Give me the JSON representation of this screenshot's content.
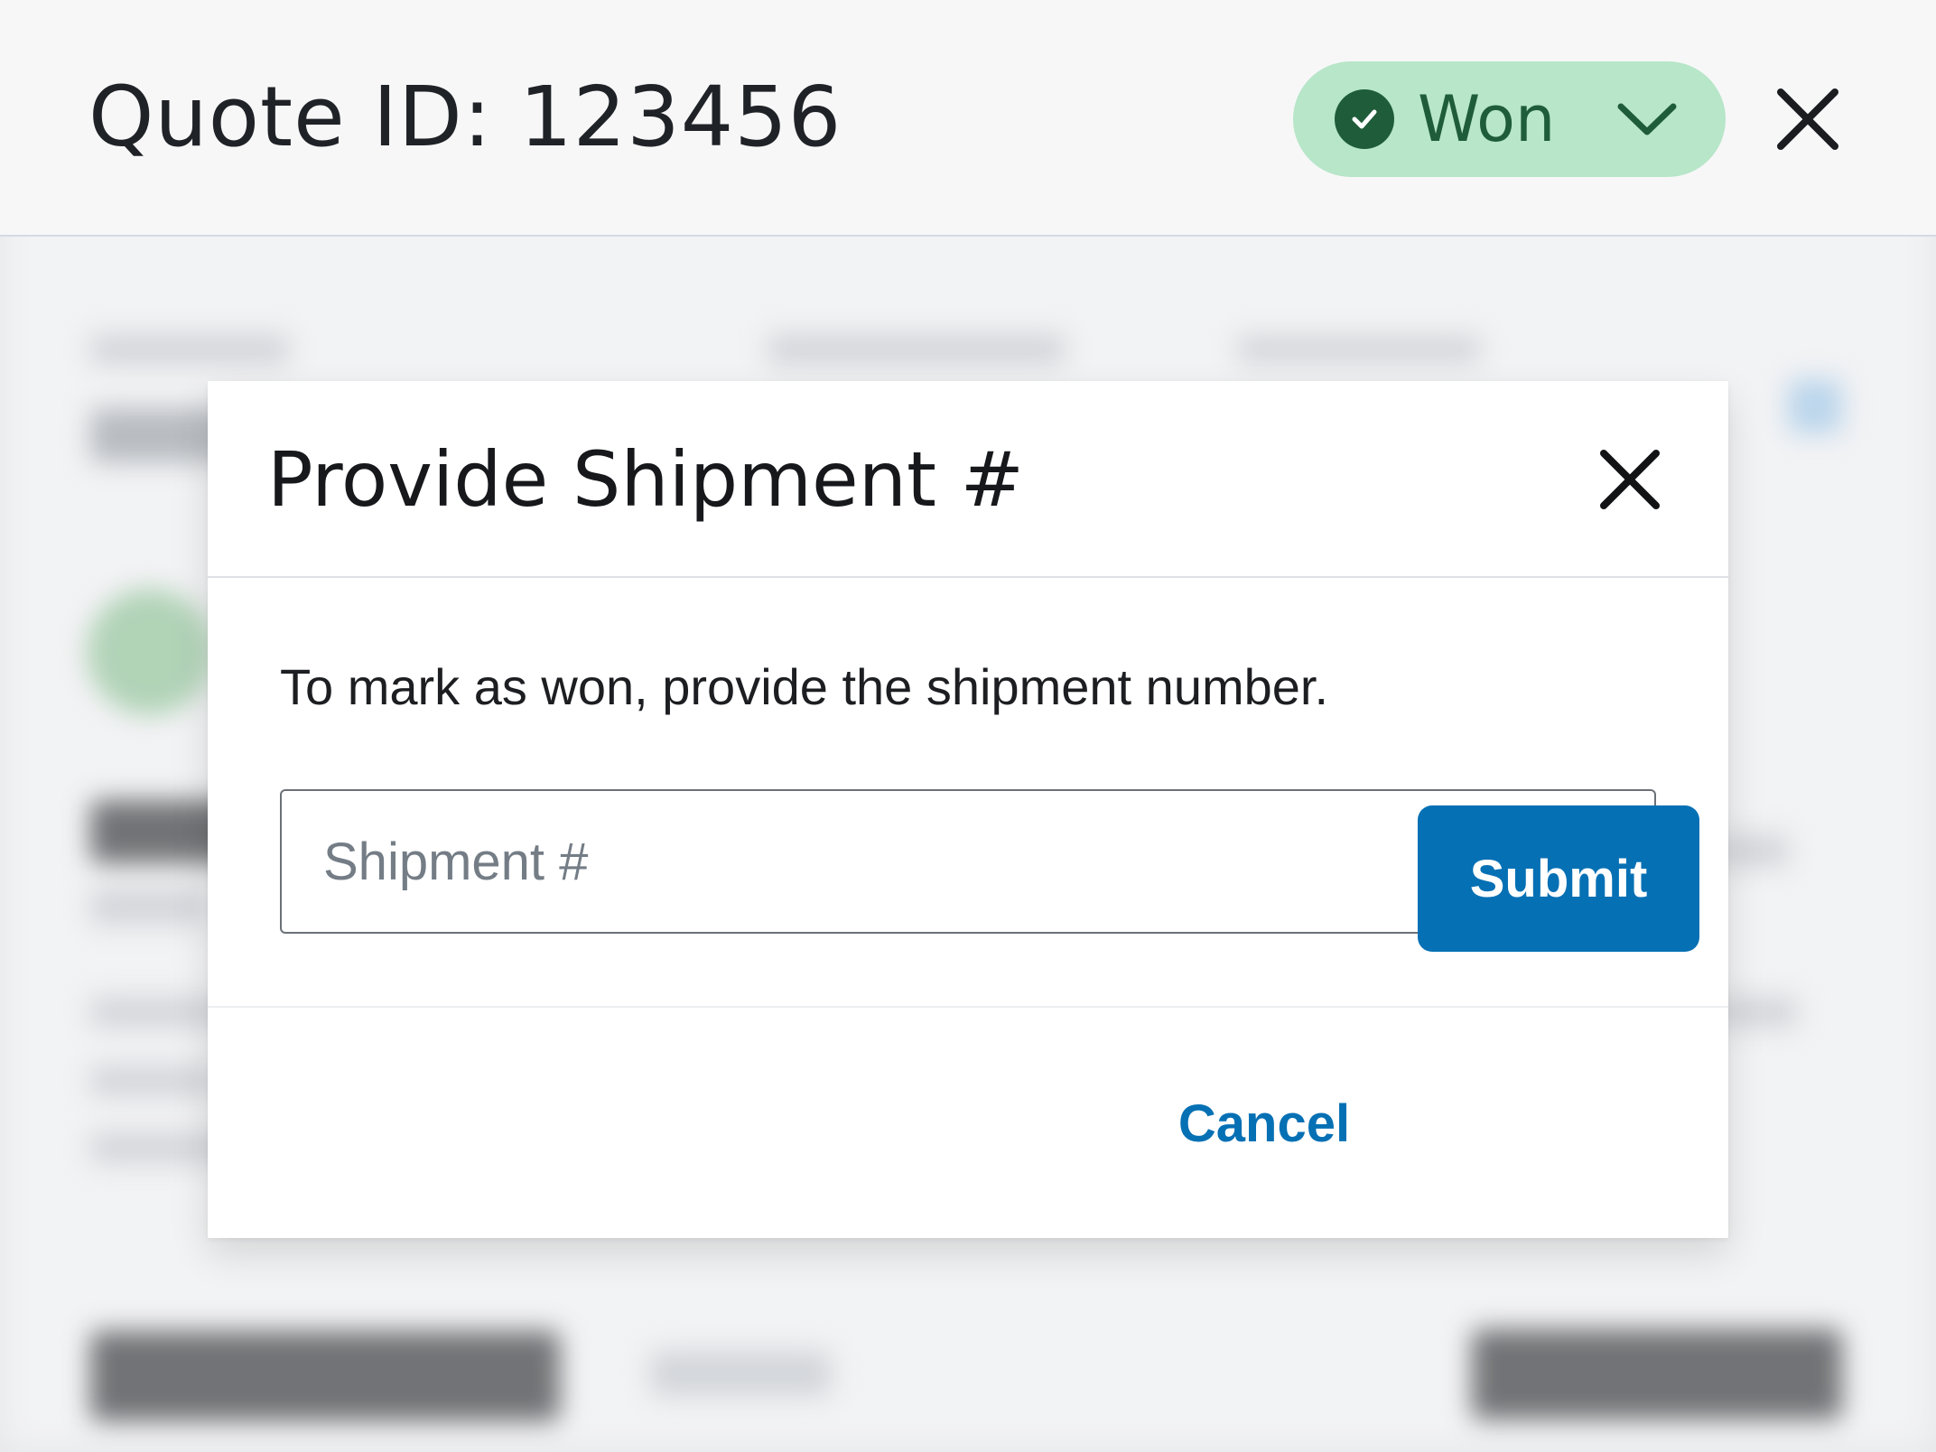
{
  "header": {
    "title": "Quote ID: 123456",
    "status": {
      "label": "Won",
      "icon": "check-circle-icon",
      "chevron_icon": "chevron-down-icon",
      "background": "#b7e6c8",
      "color": "#1f5c3a"
    },
    "close_icon": "close-icon"
  },
  "modal": {
    "title": "Provide Shipment #",
    "close_icon": "close-icon",
    "message": "To mark as won, provide the shipment number.",
    "input": {
      "placeholder": "Shipment #",
      "value": ""
    },
    "cancel_label": "Cancel",
    "submit_label": "Submit",
    "accent": "#0670b4"
  }
}
